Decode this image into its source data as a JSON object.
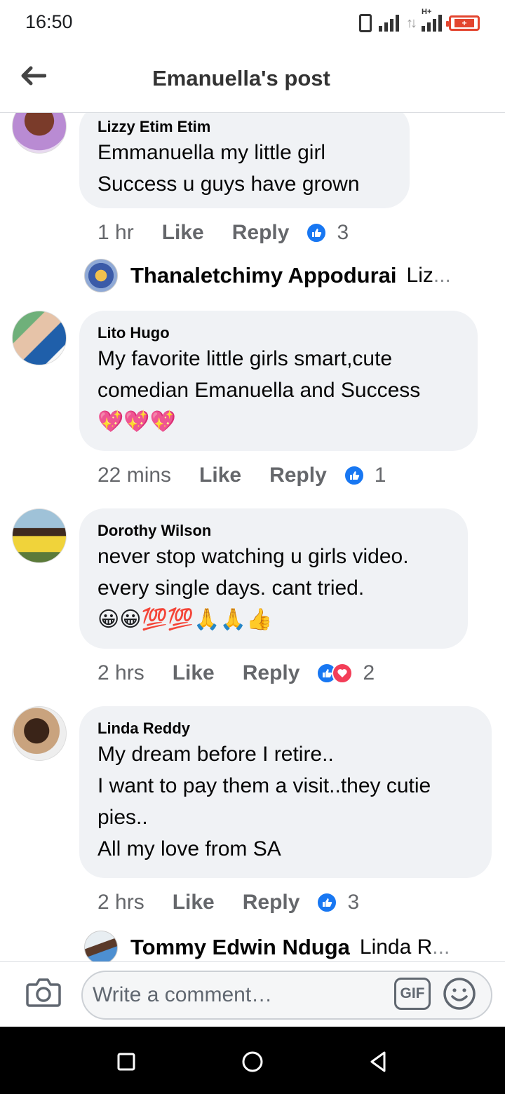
{
  "status_bar": {
    "time": "16:50",
    "network": "H+",
    "battery_label": "+"
  },
  "header": {
    "title": "Emanuella's post",
    "back_icon": "arrow-left-icon"
  },
  "comments": [
    {
      "author": "Lizzy Etim Etim",
      "text": "Emmanuella my little girl\nSuccess u guys have grown",
      "time": "1 hr",
      "like_label": "Like",
      "reply_label": "Reply",
      "reactions": [
        "like"
      ],
      "reaction_count": "3",
      "reply_preview": {
        "name": "Thanaletchimy Appodurai",
        "snippet": "Liz"
      }
    },
    {
      "author": "Lito Hugo",
      "text": "My favorite little girls smart,cute\ncomedian Emanuella and Success",
      "emojis": "💖💖💖",
      "time": "22 mins",
      "like_label": "Like",
      "reply_label": "Reply",
      "reactions": [
        "like"
      ],
      "reaction_count": "1"
    },
    {
      "author": "Dorothy Wilson",
      "text": "never stop watching u girls video.\nevery single days. cant tried.",
      "emojis": "😀😀💯💯🙏🙏👍",
      "time": "2 hrs",
      "like_label": "Like",
      "reply_label": "Reply",
      "reactions": [
        "like",
        "love"
      ],
      "reaction_count": "2"
    },
    {
      "author": "Linda Reddy",
      "text": "My dream before I retire..\nI want to pay them a visit..they cutie\npies..\nAll my love from SA",
      "time": "2 hrs",
      "like_label": "Like",
      "reply_label": "Reply",
      "reactions": [
        "like"
      ],
      "reaction_count": "3",
      "reply_preview": {
        "name": "Tommy Edwin Nduga",
        "snippet": "Linda R"
      }
    }
  ],
  "composer": {
    "placeholder": "Write a comment…",
    "gif_label": "GIF",
    "camera_icon": "camera-icon",
    "emoji_icon": "smiley-icon"
  },
  "navbar": {
    "icons": [
      "recents-square-icon",
      "home-circle-icon",
      "back-triangle-icon"
    ]
  },
  "colors": {
    "accent": "#1877f2",
    "love": "#f33e58",
    "bubble": "#f0f2f5",
    "secondary_text": "#65676b",
    "battery": "#e3452f"
  }
}
